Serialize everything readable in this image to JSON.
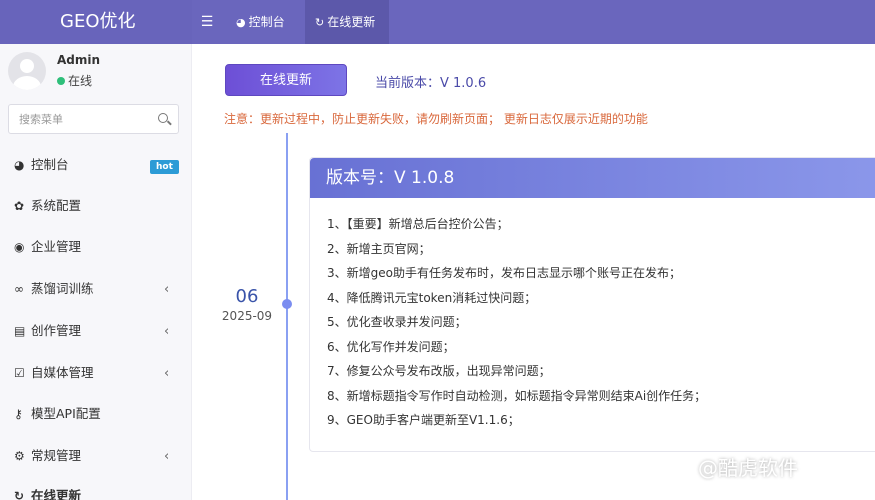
{
  "app": {
    "title": "GEO优化"
  },
  "header": {
    "menu_icon": "hamburger-icon",
    "tabs": [
      {
        "label": "控制台",
        "icon": "dashboard-icon"
      },
      {
        "label": "在线更新",
        "icon": "refresh-icon"
      }
    ]
  },
  "user": {
    "name": "Admin",
    "status": "在线",
    "status_color": "#2fbf7a"
  },
  "search": {
    "placeholder": "搜索菜单"
  },
  "sidebar": {
    "items": [
      {
        "label": "控制台",
        "icon": "dashboard-icon",
        "badge": "hot"
      },
      {
        "label": "系统配置",
        "icon": "gear-icon"
      },
      {
        "label": "企业管理",
        "icon": "user-circle-icon"
      },
      {
        "label": "蒸馏词训练",
        "icon": "link-icon",
        "chevron": "‹"
      },
      {
        "label": "创作管理",
        "icon": "document-icon",
        "chevron": "‹"
      },
      {
        "label": "自媒体管理",
        "icon": "checkbox-icon",
        "chevron": "‹"
      },
      {
        "label": "模型API配置",
        "icon": "key-icon"
      },
      {
        "label": "常规管理",
        "icon": "gears-icon",
        "chevron": "‹"
      },
      {
        "label": "在线更新",
        "icon": "refresh-icon"
      }
    ]
  },
  "main": {
    "update_button": "在线更新",
    "current_version": "当前版本：V 1.0.6",
    "notice": "注意：更新过程中，防止更新失败，请勿刷新页面；  更新日志仅展示近期的功能",
    "timeline": [
      {
        "day": "06",
        "month": "2025-09",
        "title": "版本号：V 1.0.8",
        "changes": [
          "1、【重要】新增总后台控价公告；",
          "2、新增主页官网；",
          "3、新增geo助手有任务发布时，发布日志显示哪个账号正在发布；",
          "4、降低腾讯元宝token消耗过快问题；",
          "5、优化查收录并发问题；",
          "6、优化写作并发问题；",
          "7、修复公众号发布改版，出现异常问题；",
          "8、新增标题指令写作时自动检测，如标题指令异常则结束Ai创作任务；",
          "9、GEO助手客户端更新至V1.1.6；"
        ]
      }
    ]
  },
  "watermark": "@酷虎软件",
  "colors": {
    "header": "#6a66bd",
    "accent": "#6d4fd6",
    "notice": "#d9683c",
    "badge": "#2c9bd6"
  }
}
